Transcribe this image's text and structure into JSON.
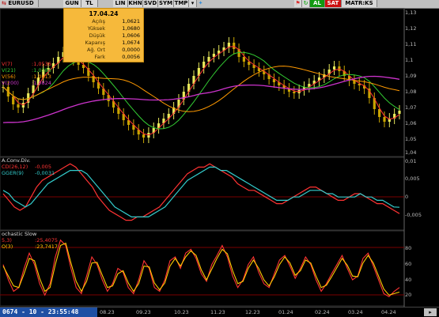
{
  "toolbar": {
    "symbol": "EURUSD",
    "buttons": [
      "GUN",
      "TL",
      "LIN",
      "KHN",
      "SVD",
      "SYM",
      "TMP"
    ],
    "right_buttons": [
      "AL",
      "SAT",
      "MATR:KS"
    ]
  },
  "tooltip": {
    "date": "17.04.24",
    "rows": [
      {
        "label": "Açılış",
        "value": "1,0621"
      },
      {
        "label": "Yüksek",
        "value": "1,0680"
      },
      {
        "label": "Düşük",
        "value": "1,0606"
      },
      {
        "label": "Kapanış",
        "value": "1,0674"
      },
      {
        "label": "Ağ. Ort",
        "value": "0,0000"
      },
      {
        "label": "Fark",
        "value": "0,0056"
      }
    ]
  },
  "price_panel": {
    "legend": [
      {
        "name": "V(7)",
        "value": ":1,0536",
        "color": "#ff3333"
      },
      {
        "name": "V(21)",
        "value": ":1,0783",
        "color": "#33cc33"
      },
      {
        "name": "V(56)",
        "value": ":1,0813",
        "color": "#ff9900"
      },
      {
        "name": "V(200)",
        "value": ":1,0824",
        "color": "#cc33cc"
      }
    ],
    "axis": [
      "1,13",
      "1,12",
      "1,11",
      "1,1",
      "1,09",
      "1,08",
      "1,07",
      "1,06",
      "1,05",
      "1,04"
    ]
  },
  "macd_panel": {
    "title": "A.Conv.Div.",
    "legend": [
      {
        "name": "CD(26,12)",
        "value": "-0,005",
        "color": "#ff3333"
      },
      {
        "name": "GGER(9)",
        "value": "-0,0031",
        "color": "#33cccc"
      }
    ],
    "axis": [
      "0,01",
      "0,005",
      "0",
      "-0,005"
    ]
  },
  "stoch_panel": {
    "title": "ochastic Slow",
    "legend": [
      {
        "name": "5,3)",
        "value": ":25,4075",
        "color": "#ff3333"
      },
      {
        "name": "O(3)",
        "value": ":23,7417",
        "color": "#ffcc00"
      }
    ],
    "axis": [
      "80",
      "60",
      "40",
      "20"
    ]
  },
  "status": {
    "ticker": "0674 - 10 - 23:55:48",
    "dates": [
      "08.23",
      "09.23",
      "10.23",
      "11.23",
      "12.23",
      "01.24",
      "02.24",
      "03.24",
      "04.24"
    ]
  },
  "chart_data": [
    {
      "type": "candlestick",
      "ylim": [
        1.04,
        1.13
      ],
      "closes": [
        1.082,
        1.076,
        1.071,
        1.069,
        1.072,
        1.078,
        1.083,
        1.088,
        1.093,
        1.094,
        1.097,
        1.101,
        1.104,
        1.102,
        1.099,
        1.096,
        1.094,
        1.089,
        1.085,
        1.081,
        1.077,
        1.073,
        1.069,
        1.065,
        1.061,
        1.058,
        1.055,
        1.052,
        1.05,
        1.053,
        1.056,
        1.059,
        1.062,
        1.065,
        1.069,
        1.074,
        1.079,
        1.084,
        1.089,
        1.094,
        1.098,
        1.101,
        1.103,
        1.105,
        1.107,
        1.11,
        1.106,
        1.101,
        1.098,
        1.096,
        1.094,
        1.092,
        1.09,
        1.087,
        1.085,
        1.083,
        1.081,
        1.079,
        1.078,
        1.08,
        1.082,
        1.084,
        1.086,
        1.088,
        1.09,
        1.093,
        1.095,
        1.092,
        1.089,
        1.086,
        1.084,
        1.083,
        1.081,
        1.075,
        1.068,
        1.063,
        1.06,
        1.062,
        1.065,
        1.067
      ]
    },
    {
      "type": "line",
      "ylim": [
        -0.009,
        0.011
      ],
      "series": [
        {
          "name": "CD(26,12)",
          "values": [
            0.001,
            -0.001,
            -0.003,
            -0.004,
            -0.003,
            0.0,
            0.003,
            0.005,
            0.006,
            0.007,
            0.008,
            0.009,
            0.01,
            0.009,
            0.007,
            0.005,
            0.003,
            0.0,
            -0.002,
            -0.004,
            -0.005,
            -0.006,
            -0.007,
            -0.007,
            -0.006,
            -0.006,
            -0.005,
            -0.004,
            -0.003,
            -0.001,
            0.001,
            0.003,
            0.005,
            0.007,
            0.008,
            0.009,
            0.009,
            0.01,
            0.009,
            0.008,
            0.007,
            0.006,
            0.004,
            0.003,
            0.002,
            0.002,
            0.001,
            0.0,
            -0.001,
            -0.002,
            -0.002,
            -0.001,
            0.0,
            0.001,
            0.002,
            0.003,
            0.003,
            0.002,
            0.001,
            0.0,
            -0.001,
            -0.001,
            0.0,
            0.001,
            0.001,
            0.0,
            -0.001,
            -0.002,
            -0.002,
            -0.003,
            -0.004,
            -0.005
          ]
        },
        {
          "name": "GGER(9)",
          "values": [
            0.002,
            0.001,
            -0.001,
            -0.002,
            -0.003,
            -0.002,
            0.0,
            0.002,
            0.004,
            0.005,
            0.006,
            0.007,
            0.008,
            0.008,
            0.008,
            0.007,
            0.005,
            0.003,
            0.001,
            -0.001,
            -0.003,
            -0.004,
            -0.005,
            -0.006,
            -0.006,
            -0.006,
            -0.006,
            -0.005,
            -0.004,
            -0.003,
            -0.001,
            0.001,
            0.003,
            0.005,
            0.006,
            0.007,
            0.008,
            0.009,
            0.009,
            0.008,
            0.008,
            0.007,
            0.006,
            0.005,
            0.004,
            0.003,
            0.002,
            0.001,
            0.0,
            -0.001,
            -0.001,
            -0.001,
            0.0,
            0.0,
            0.001,
            0.002,
            0.002,
            0.002,
            0.001,
            0.001,
            0.0,
            0.0,
            0.0,
            0.0,
            0.001,
            0.0,
            0.0,
            -0.001,
            -0.001,
            -0.002,
            -0.003,
            -0.0031
          ]
        }
      ]
    },
    {
      "type": "line",
      "ylim": [
        10,
        100
      ],
      "series": [
        {
          "name": "5,3)",
          "values": [
            60,
            40,
            25,
            30,
            55,
            75,
            60,
            35,
            20,
            35,
            70,
            92,
            85,
            55,
            30,
            22,
            45,
            70,
            60,
            40,
            25,
            35,
            55,
            50,
            30,
            22,
            40,
            65,
            55,
            30,
            25,
            40,
            65,
            70,
            55,
            75,
            80,
            68,
            48,
            38,
            60,
            72,
            85,
            70,
            45,
            30,
            40,
            60,
            70,
            50,
            35,
            30,
            48,
            66,
            72,
            58,
            42,
            55,
            70,
            60,
            40,
            25,
            35,
            48,
            60,
            72,
            55,
            40,
            45,
            68,
            75,
            58,
            40,
            22,
            18,
            25,
            30
          ]
        },
        {
          "name": "O(3)",
          "values": [
            58,
            45,
            32,
            30,
            48,
            68,
            65,
            42,
            25,
            30,
            60,
            85,
            88,
            62,
            38,
            25,
            38,
            62,
            63,
            46,
            30,
            32,
            48,
            52,
            36,
            25,
            35,
            58,
            57,
            36,
            27,
            36,
            58,
            68,
            58,
            70,
            78,
            72,
            53,
            40,
            54,
            68,
            80,
            74,
            52,
            35,
            38,
            55,
            66,
            55,
            40,
            32,
            44,
            60,
            70,
            62,
            46,
            52,
            66,
            62,
            45,
            30,
            33,
            44,
            56,
            68,
            59,
            45,
            44,
            62,
            72,
            62,
            45,
            28,
            20,
            22,
            24
          ]
        }
      ]
    }
  ]
}
